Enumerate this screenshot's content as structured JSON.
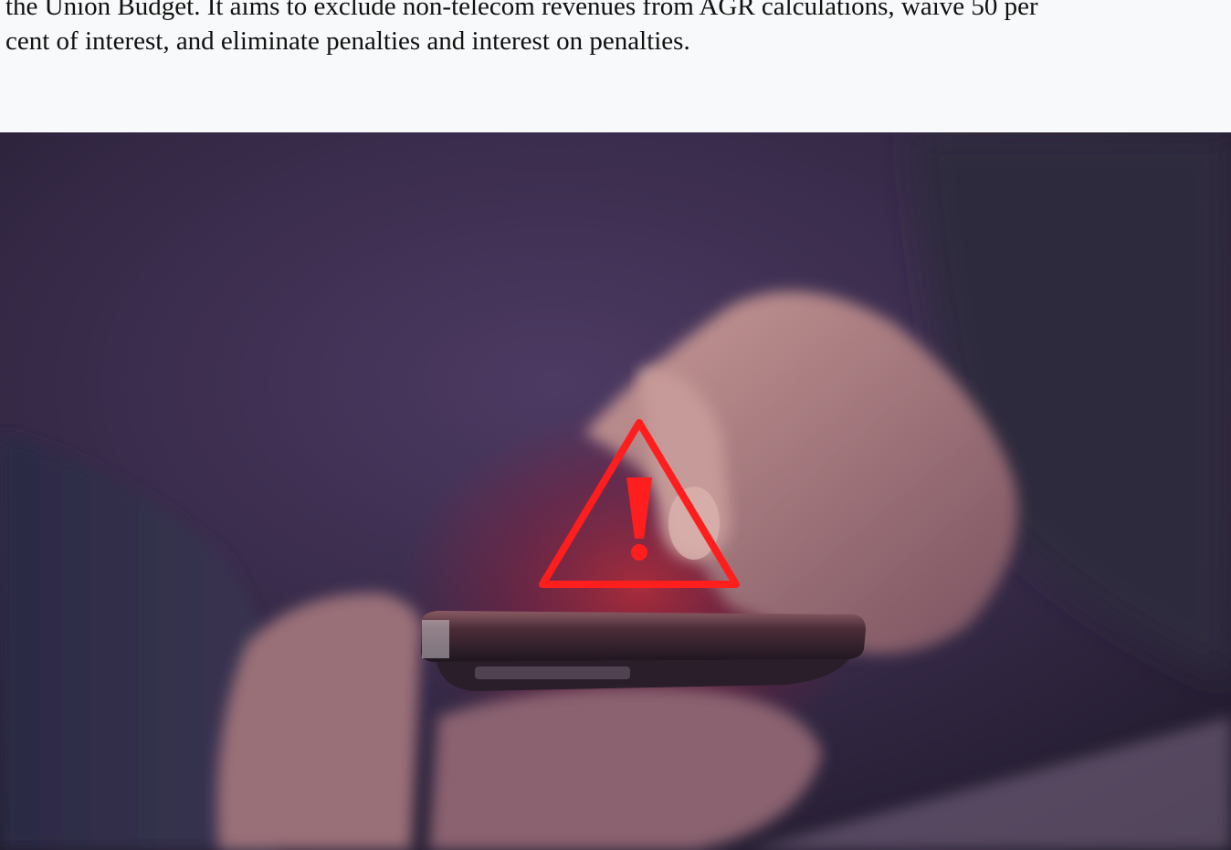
{
  "article": {
    "paragraph_line_1": "the Union Budget. It aims to exclude non-telecom revenues from AGR calculations, waive 50 per",
    "paragraph_line_2": "cent of interest, and eliminate penalties and interest on penalties."
  },
  "hero_image": {
    "warning_color": "#ff1e1e",
    "icon": "warning-triangle-icon"
  }
}
